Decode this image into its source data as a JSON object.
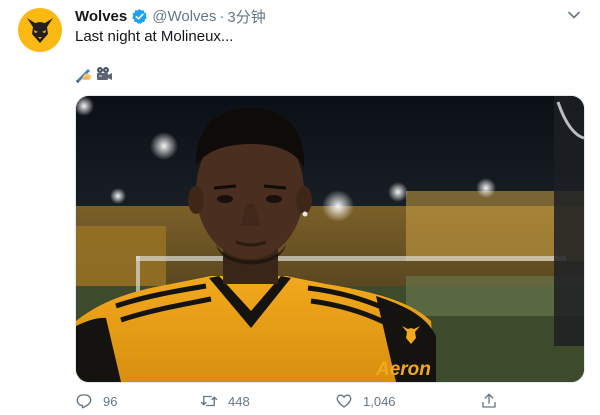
{
  "tweet": {
    "display_name": "Wolves",
    "handle": "@Wolves",
    "separator": "·",
    "time": "3分钟",
    "text": "Last night at Molineux...",
    "emojis": [
      "writing-hand-emoji",
      "movie-camera-emoji"
    ]
  },
  "media": {
    "shirt_sponsor": "Aeron"
  },
  "actions": {
    "replies": "96",
    "retweets": "448",
    "likes": "1,046"
  },
  "colors": {
    "brand_gold": "#fdb913",
    "verified_blue": "#1da1f2",
    "muted_text": "#657786"
  }
}
